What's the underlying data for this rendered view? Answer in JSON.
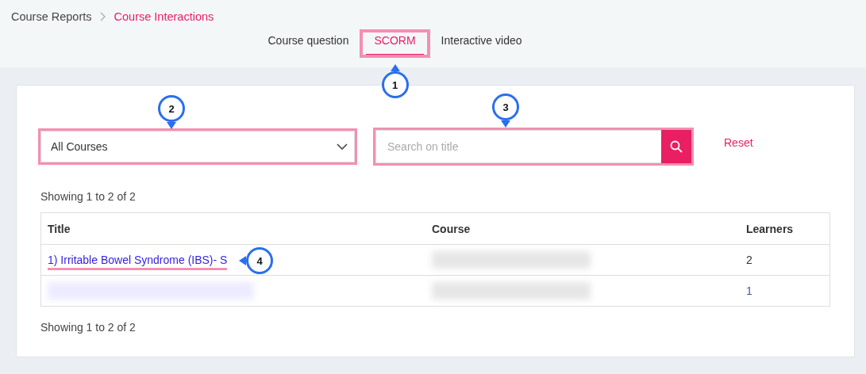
{
  "breadcrumbs": [
    {
      "label": "Course Reports",
      "current": false
    },
    {
      "label": "Course Interactions",
      "current": true
    }
  ],
  "tabs": [
    {
      "label": "Course question",
      "selected": false,
      "highlighted": false
    },
    {
      "label": "SCORM",
      "selected": true,
      "highlighted": true,
      "callout": "1"
    },
    {
      "label": "Interactive video",
      "selected": false,
      "highlighted": false
    }
  ],
  "filters": {
    "course_select": {
      "value": "All Courses",
      "highlighted": true,
      "callout": "2"
    },
    "search": {
      "placeholder": "Search on title",
      "highlighted": true,
      "callout": "3"
    },
    "reset": "Reset"
  },
  "summary_top": "Showing 1 to 2 of 2",
  "table": {
    "columns": [
      "Title",
      "Course",
      "Learners"
    ],
    "rows": [
      {
        "cells": [
          {
            "kind": "link",
            "text": "1) Irritable Bowel Syndrome (IBS)- S",
            "underlined": true,
            "callout": "4"
          },
          {
            "kind": "redacted"
          },
          {
            "kind": "text",
            "text": "2"
          }
        ]
      },
      {
        "cells": [
          {
            "kind": "redacted"
          },
          {
            "kind": "redacted"
          },
          {
            "kind": "link",
            "text": "1",
            "underlined": false
          }
        ]
      }
    ]
  },
  "summary_bottom": "Showing 1 to 2 of 2"
}
